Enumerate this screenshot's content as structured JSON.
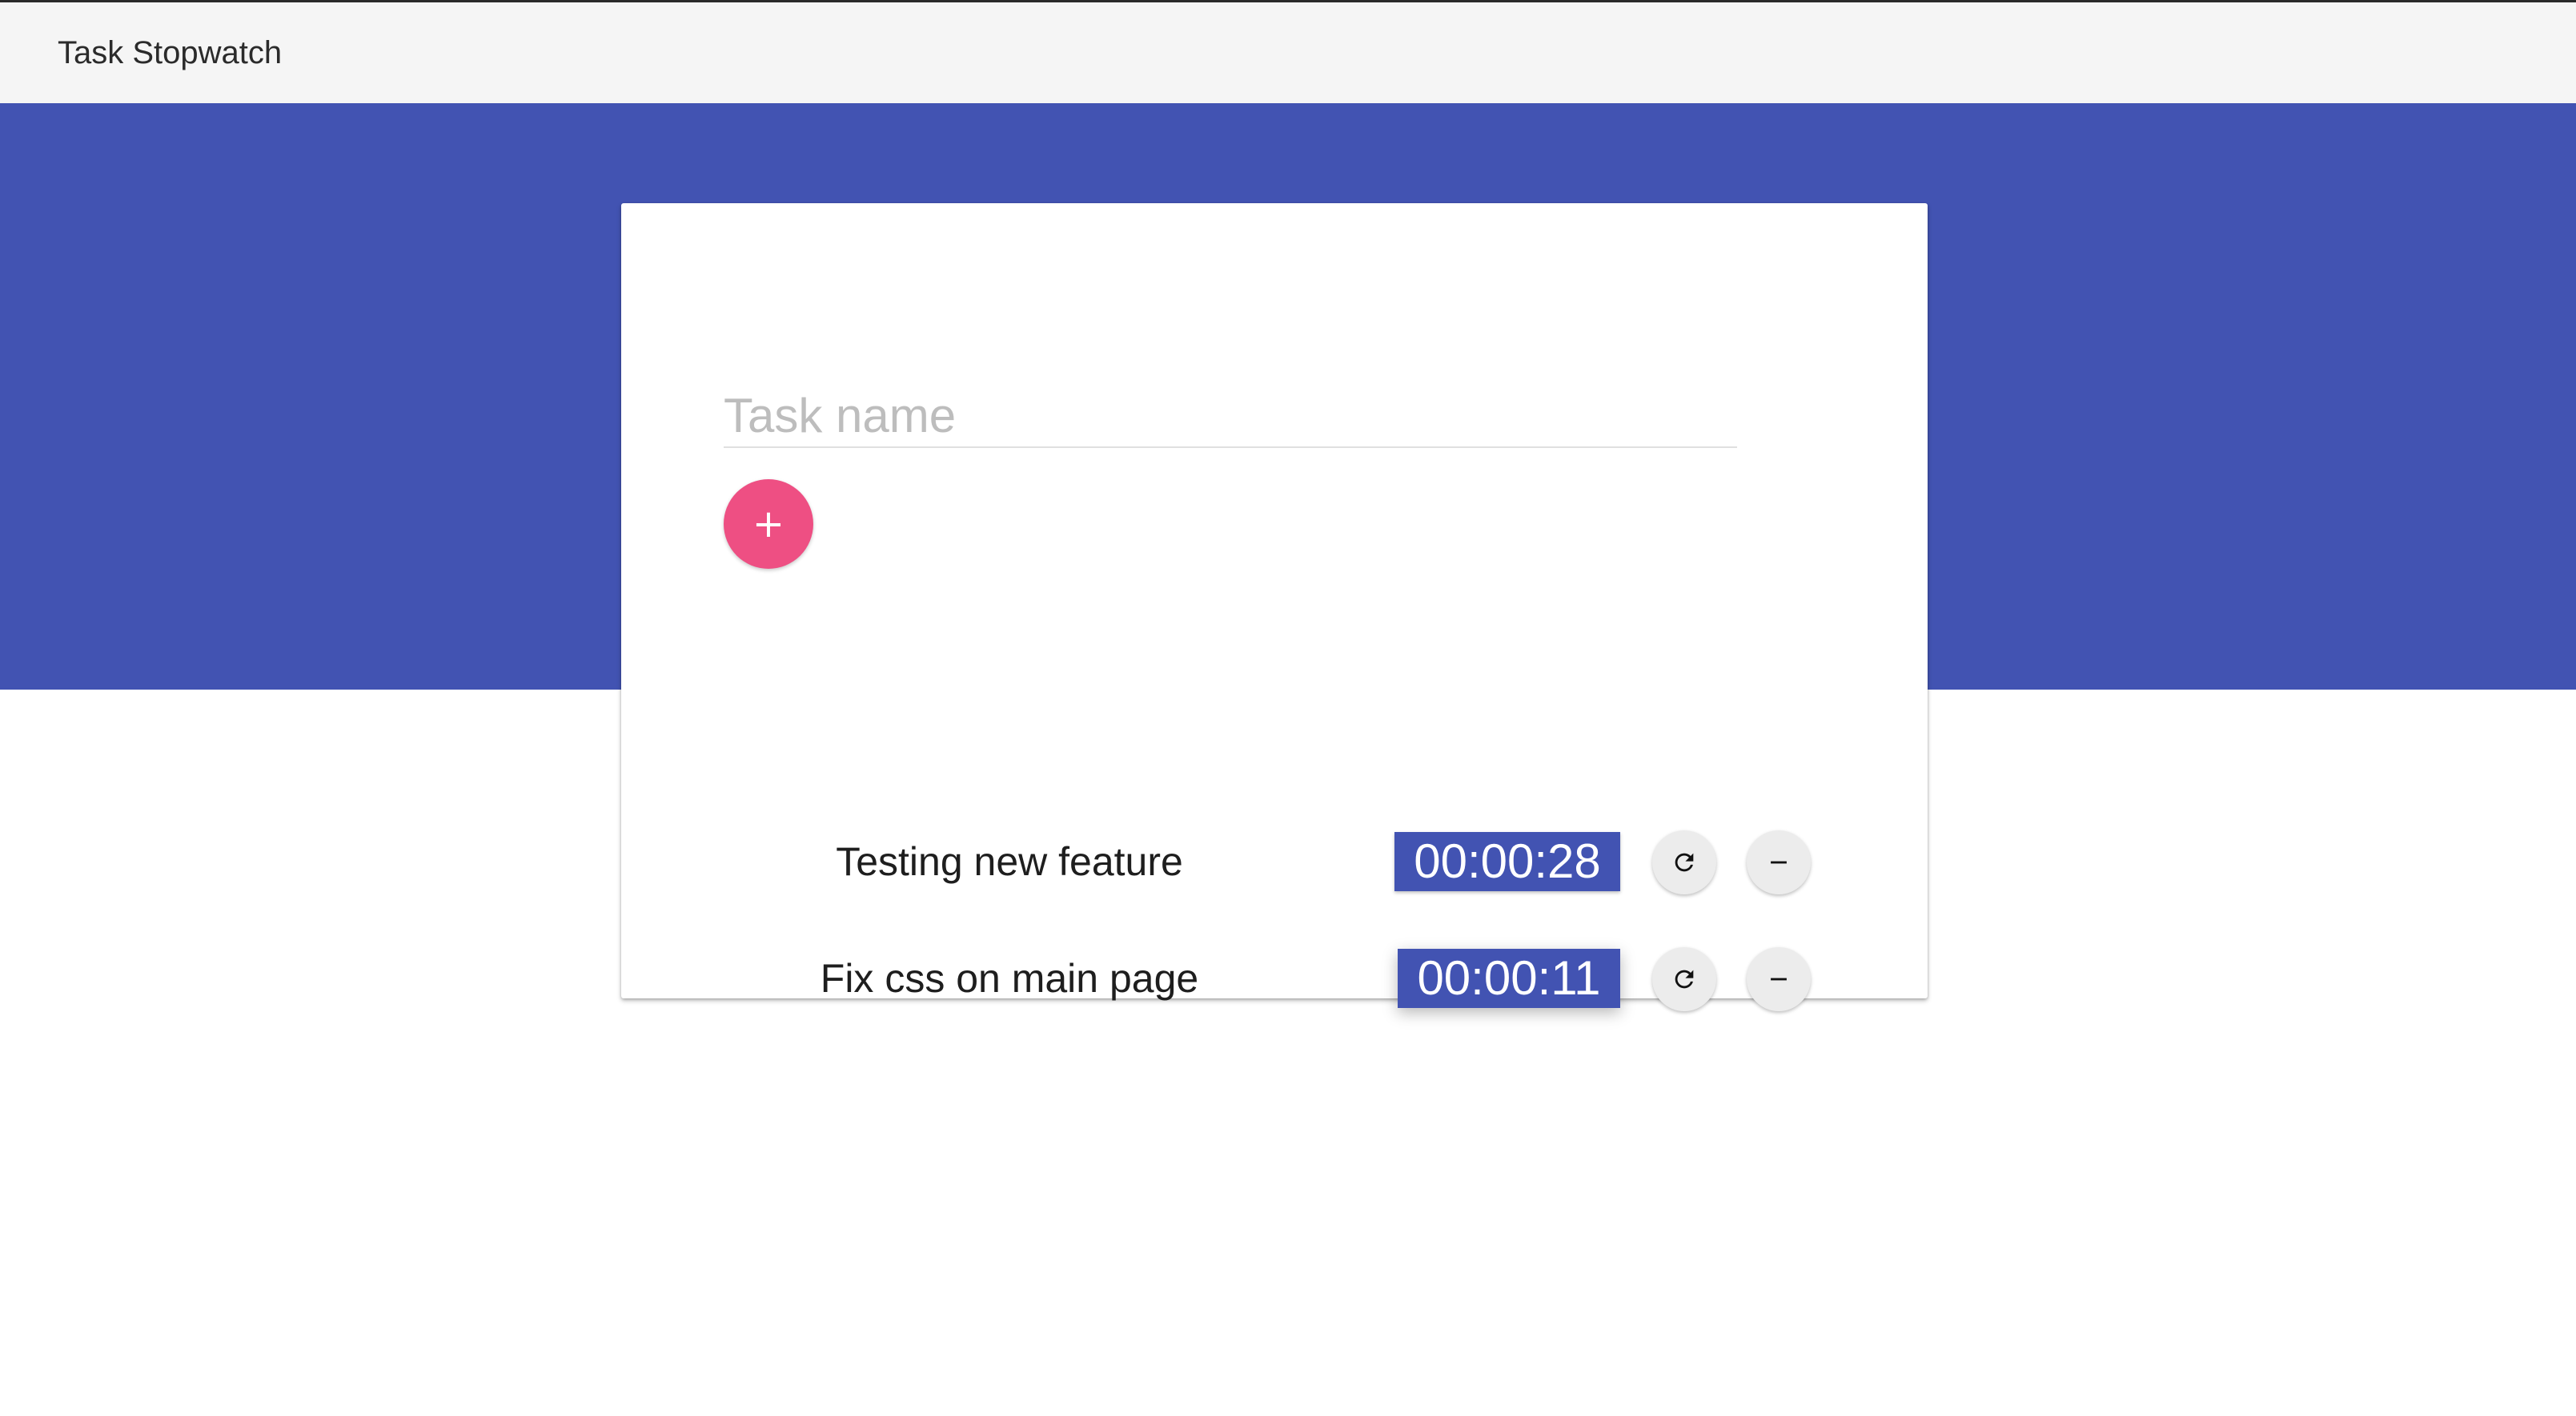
{
  "app": {
    "title": "Task Stopwatch"
  },
  "task_form": {
    "placeholder": "Task name",
    "value": "",
    "add_button_label": "+"
  },
  "tasks": [
    {
      "name": "Testing new feature",
      "elapsed": "00:00:28",
      "restart_icon": "restart-icon",
      "remove_icon": "minus-icon"
    },
    {
      "name": "Fix css on main page",
      "elapsed": "00:00:11",
      "restart_icon": "restart-icon",
      "remove_icon": "minus-icon"
    }
  ],
  "colors": {
    "primary": "#4253b2",
    "accent": "#ee4f83",
    "appbar": "#f5f5f5"
  }
}
